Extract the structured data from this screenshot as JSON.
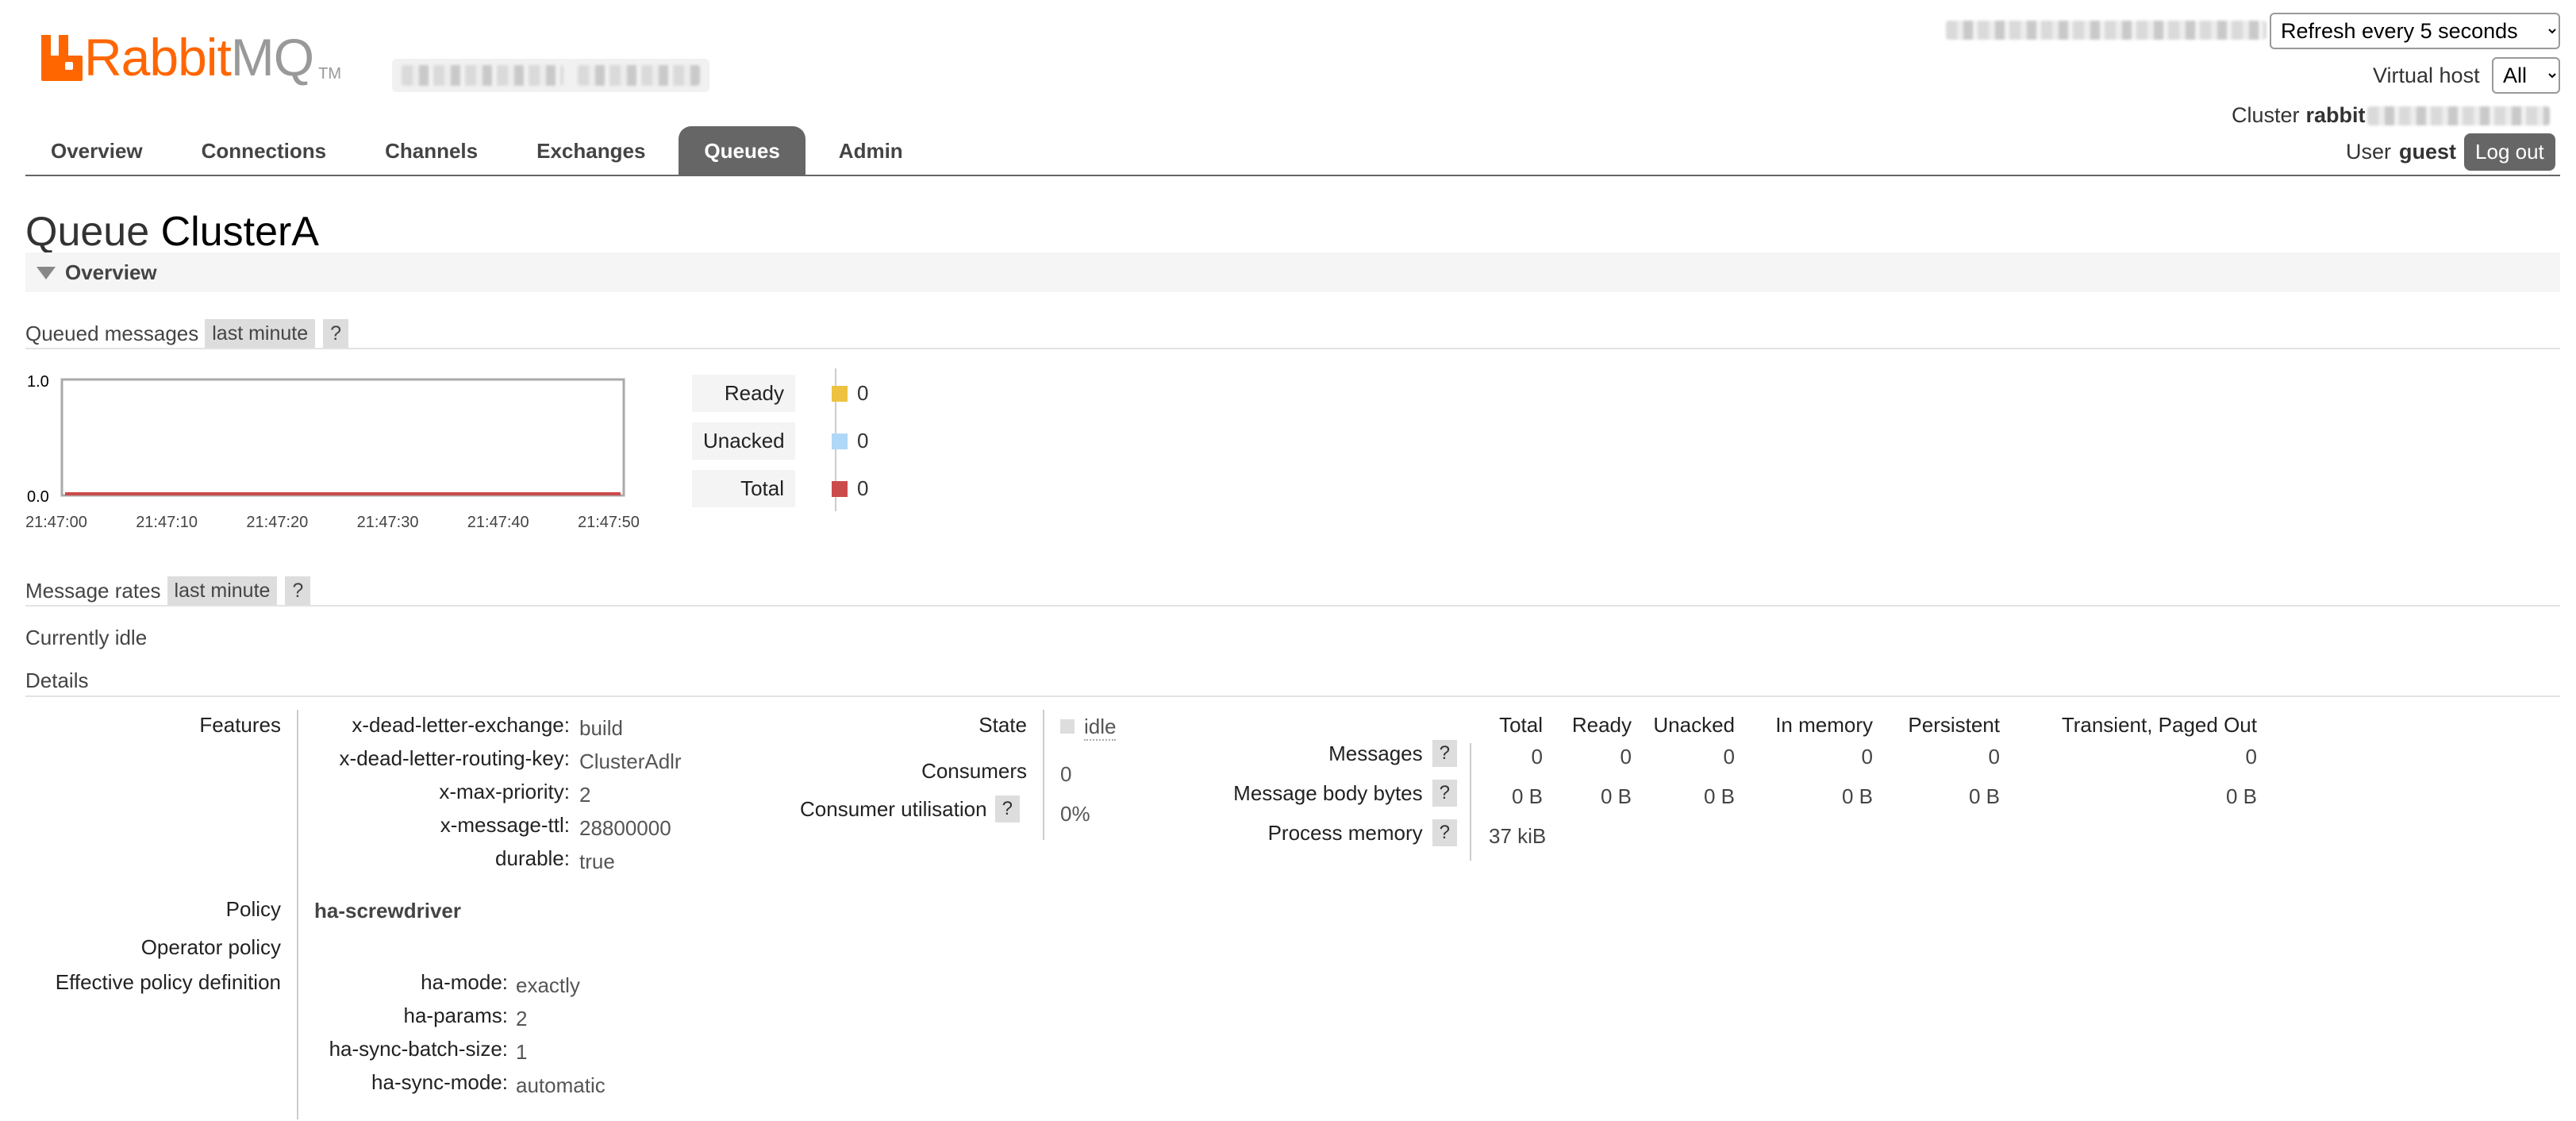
{
  "header": {
    "brand_rabbit": "Rabbit",
    "brand_mq": "MQ",
    "brand_tm": "TM",
    "refresh_select": "Refresh every 5 seconds",
    "vhost_label": "Virtual host",
    "vhost_select": "All",
    "cluster_label": "Cluster",
    "cluster_name": "rabbit",
    "user_label": "User",
    "user_name": "guest",
    "logout": "Log out"
  },
  "tabs": [
    "Overview",
    "Connections",
    "Channels",
    "Exchanges",
    "Queues",
    "Admin"
  ],
  "active_tab": "Queues",
  "page": {
    "title_prefix": "Queue",
    "title_name": "ClusterA",
    "section_overview": "Overview"
  },
  "queued_messages": {
    "label": "Queued messages",
    "range": "last minute",
    "help": "?",
    "chart_data": {
      "type": "line",
      "x": [
        "21:47:00",
        "21:47:10",
        "21:47:20",
        "21:47:30",
        "21:47:40",
        "21:47:50"
      ],
      "ylim": [
        0.0,
        1.0
      ],
      "y_ticks": [
        "1.0",
        "0.0"
      ],
      "series": [
        {
          "name": "Ready",
          "values": [
            0,
            0,
            0,
            0,
            0,
            0
          ],
          "color": "#edc240"
        },
        {
          "name": "Unacked",
          "values": [
            0,
            0,
            0,
            0,
            0,
            0
          ],
          "color": "#afd8f8"
        },
        {
          "name": "Total",
          "values": [
            0,
            0,
            0,
            0,
            0,
            0
          ],
          "color": "#cb4b4b"
        }
      ]
    },
    "legend": [
      {
        "label": "Ready",
        "value": "0",
        "color": "#edc240"
      },
      {
        "label": "Unacked",
        "value": "0",
        "color": "#afd8f8"
      },
      {
        "label": "Total",
        "value": "0",
        "color": "#cb4b4b"
      }
    ]
  },
  "message_rates": {
    "label": "Message rates",
    "range": "last minute",
    "help": "?",
    "status": "Currently idle"
  },
  "details": {
    "label": "Details",
    "features_label": "Features",
    "features": [
      {
        "key": "x-dead-letter-exchange:",
        "value": "build"
      },
      {
        "key": "x-dead-letter-routing-key:",
        "value": "ClusterAdlr"
      },
      {
        "key": "x-max-priority:",
        "value": "2"
      },
      {
        "key": "x-message-ttl:",
        "value": "28800000"
      },
      {
        "key": "durable:",
        "value": "true"
      }
    ],
    "policy_label": "Policy",
    "policy_value": "ha-screwdriver",
    "operator_policy_label": "Operator policy",
    "effective_policy_label": "Effective policy definition",
    "effective_policy": [
      {
        "key": "ha-mode:",
        "value": "exactly"
      },
      {
        "key": "ha-params:",
        "value": "2"
      },
      {
        "key": "ha-sync-batch-size:",
        "value": "1"
      },
      {
        "key": "ha-sync-mode:",
        "value": "automatic"
      }
    ],
    "state_label": "State",
    "state_value": "idle",
    "consumers_label": "Consumers",
    "consumers_value": "0",
    "consumer_util_label": "Consumer utilisation",
    "consumer_util_help": "?",
    "consumer_util_value": "0%",
    "stats_headers": [
      "Total",
      "Ready",
      "Unacked",
      "In memory",
      "Persistent",
      "Transient, Paged Out"
    ],
    "stats_rows": [
      {
        "label": "Messages",
        "help": "?",
        "values": [
          "0",
          "0",
          "0",
          "0",
          "0",
          "0"
        ]
      },
      {
        "label": "Message body bytes",
        "help": "?",
        "values": [
          "0 B",
          "0 B",
          "0 B",
          "0 B",
          "0 B",
          "0 B"
        ]
      },
      {
        "label": "Process memory",
        "help": "?",
        "values": [
          "37 kiB"
        ]
      }
    ]
  }
}
